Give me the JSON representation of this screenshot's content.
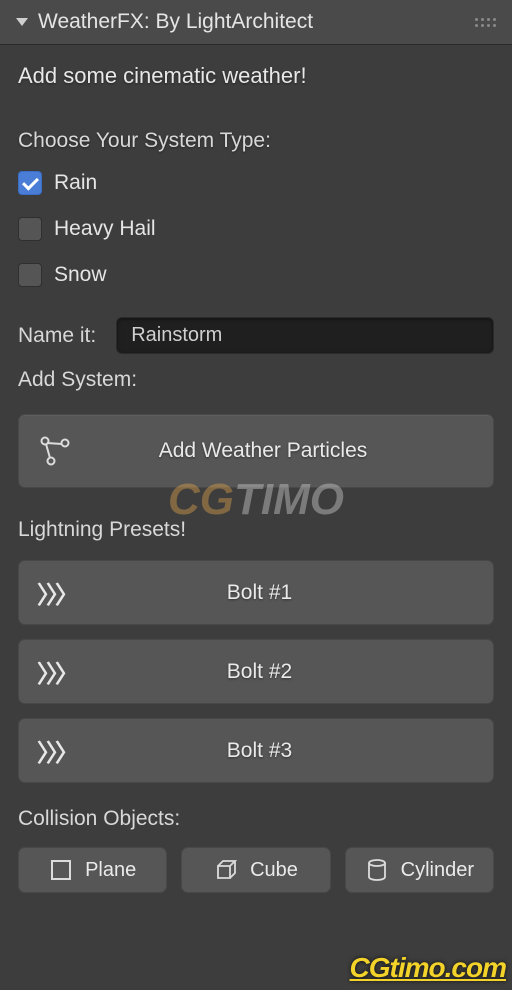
{
  "panel": {
    "title": "WeatherFX: By LightArchitect"
  },
  "intro": "Add some cinematic weather!",
  "system_type": {
    "label": "Choose Your System Type:",
    "options": [
      {
        "label": "Rain",
        "checked": true
      },
      {
        "label": "Heavy Hail",
        "checked": false
      },
      {
        "label": "Snow",
        "checked": false
      }
    ]
  },
  "name": {
    "label": "Name it:",
    "value": "Rainstorm"
  },
  "add_system": {
    "label": "Add System:",
    "button": "Add Weather Particles"
  },
  "lightning": {
    "label": "Lightning Presets!",
    "bolts": [
      "Bolt #1",
      "Bolt #2",
      "Bolt #3"
    ]
  },
  "collision": {
    "label": "Collision Objects:",
    "items": [
      "Plane",
      "Cube",
      "Cylinder"
    ]
  },
  "watermark": "CGtimo.com",
  "watermark_bg_a": "CG",
  "watermark_bg_b": "TIMO"
}
